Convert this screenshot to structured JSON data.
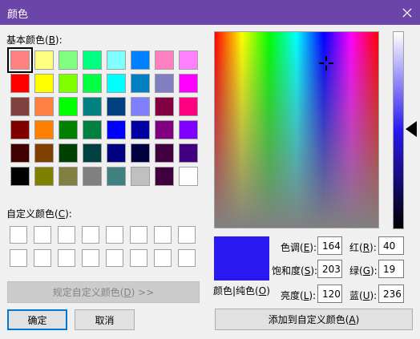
{
  "window": {
    "title": "颜色"
  },
  "labels": {
    "basic_colors": "基本颜色(",
    "basic_colors_key": "B",
    "basic_colors_end": "):",
    "custom_colors": "自定义颜色(",
    "custom_colors_key": "C",
    "custom_colors_end": "):",
    "solid_color": "颜色|纯色(",
    "solid_color_key": "O",
    "solid_color_end": ")"
  },
  "basic_colors": [
    "#ff8080",
    "#ffff80",
    "#80ff80",
    "#00ff80",
    "#80ffff",
    "#0080ff",
    "#ff80c0",
    "#ff80ff",
    "#ff0000",
    "#ffff00",
    "#80ff00",
    "#00ff40",
    "#00ffff",
    "#0080c0",
    "#8080c0",
    "#ff00ff",
    "#804040",
    "#ff8040",
    "#00ff00",
    "#008080",
    "#004080",
    "#8080ff",
    "#800040",
    "#ff0080",
    "#800000",
    "#ff8000",
    "#008000",
    "#008040",
    "#0000ff",
    "#0000a0",
    "#800080",
    "#8000ff",
    "#400000",
    "#804000",
    "#004000",
    "#004040",
    "#000080",
    "#000040",
    "#400040",
    "#400080",
    "#000000",
    "#808000",
    "#808040",
    "#808080",
    "#408080",
    "#c0c0c0",
    "#400040",
    "#ffffff"
  ],
  "selected_color": "#2a18f0",
  "fields": {
    "hue": {
      "label": "色调(",
      "key": "E",
      "end": "):",
      "value": "164"
    },
    "sat": {
      "label": "饱和度(",
      "key": "S",
      "end": "):",
      "value": "203"
    },
    "lum": {
      "label": "亮度(",
      "key": "L",
      "end": "):",
      "value": "120"
    },
    "red": {
      "label": "红(",
      "key": "R",
      "end": "):",
      "value": "40"
    },
    "green": {
      "label": "绿(",
      "key": "G",
      "end": "):",
      "value": "19"
    },
    "blue": {
      "label": "蓝(",
      "key": "U",
      "end": "):",
      "value": "236"
    }
  },
  "buttons": {
    "define_custom": "规定自定义颜色(",
    "define_custom_key": "D",
    "define_custom_end": ") >>",
    "ok": "确定",
    "cancel": "取消",
    "add_custom": "添加到自定义颜色(",
    "add_custom_key": "A",
    "add_custom_end": ")"
  }
}
